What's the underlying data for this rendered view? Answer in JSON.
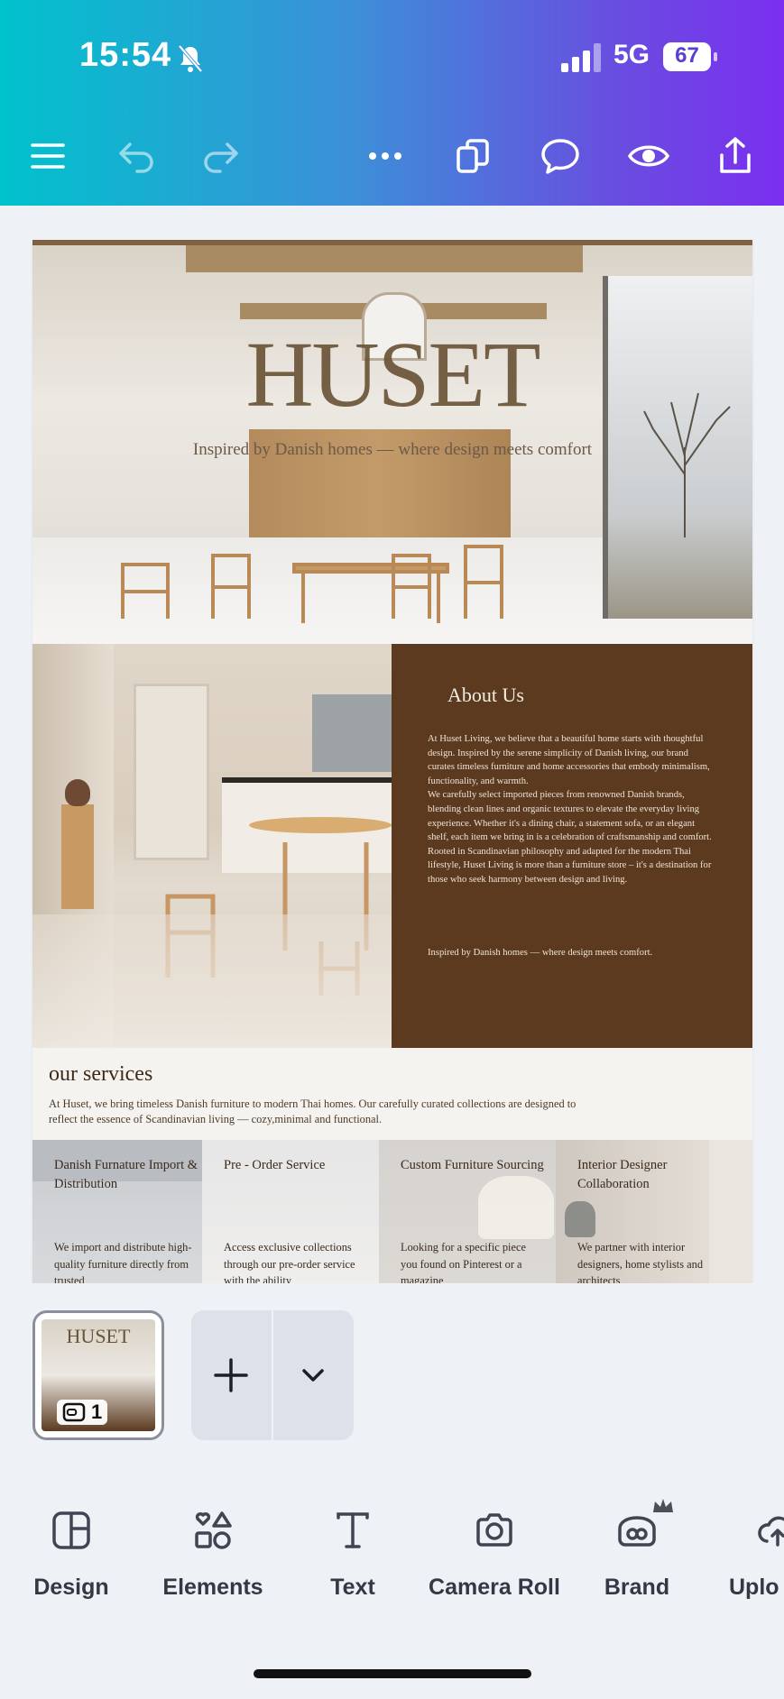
{
  "status_bar": {
    "time": "15:54",
    "network": "5G",
    "battery": "67"
  },
  "toolbar": {
    "items": [
      "menu-icon",
      "undo-icon",
      "redo-icon",
      "more-icon",
      "pages-icon",
      "comment-icon",
      "preview-icon",
      "share-icon"
    ]
  },
  "design": {
    "hero": {
      "title": "HUSET",
      "tagline": "Inspired by Danish homes — where design meets comfort"
    },
    "about": {
      "title": "About Us",
      "paragraphs": [
        "At Huset Living, we believe that a beautiful home starts with thoughtful design. Inspired by the serene simplicity of Danish living, our brand curates timeless furniture and home accessories that embody minimalism, functionality, and warmth.",
        "We carefully select imported pieces from renowned Danish brands, blending clean lines and organic textures to elevate the everyday living experience. Whether it's a dining chair, a statement sofa, or an elegant shelf, each item we bring in is a celebration of craftsmanship and comfort.",
        "Rooted in Scandinavian philosophy and adapted for the modern Thai lifestyle, Huset Living is more than a furniture store – it's a destination for those who seek harmony between design and living."
      ],
      "tagline": "Inspired by Danish homes — where design meets comfort."
    },
    "services": {
      "title": "our services",
      "body": "At Huset, we bring timeless Danish furniture to modern Thai homes. Our carefully curated collections are designed to reflect the essence of Scandinavian living — cozy,minimal and functional.",
      "cards": [
        {
          "title": "Danish Furnature Import & Distribution",
          "body": "We import and distribute high-quality furniture directly from trusted"
        },
        {
          "title": "Pre - Order Service",
          "body": "Access exclusive collections through our pre-order service with the ability"
        },
        {
          "title": "Custom Furniture Sourcing",
          "body": "Looking for a specific piece you found on Pinterest or a magazine"
        },
        {
          "title": "Interior Designer Collaboration",
          "body": "We partner with interior designers, home stylists and architects"
        }
      ]
    }
  },
  "pages_panel": {
    "thumbnail_title": "HUSET",
    "page_count": "1"
  },
  "bottom_nav": {
    "items": [
      {
        "label": "Design",
        "icon": "design-icon"
      },
      {
        "label": "Elements",
        "icon": "elements-icon"
      },
      {
        "label": "Text",
        "icon": "text-icon"
      },
      {
        "label": "Camera Roll",
        "icon": "camera-icon"
      },
      {
        "label": "Brand",
        "icon": "brand-icon"
      },
      {
        "label": "Uplo",
        "icon": "upload-icon"
      }
    ]
  },
  "colors": {
    "gradient_start": "#00c2cc",
    "gradient_end": "#7b2ff0",
    "about_bg": "#5b3a1f",
    "title_brown": "#6b5438"
  }
}
